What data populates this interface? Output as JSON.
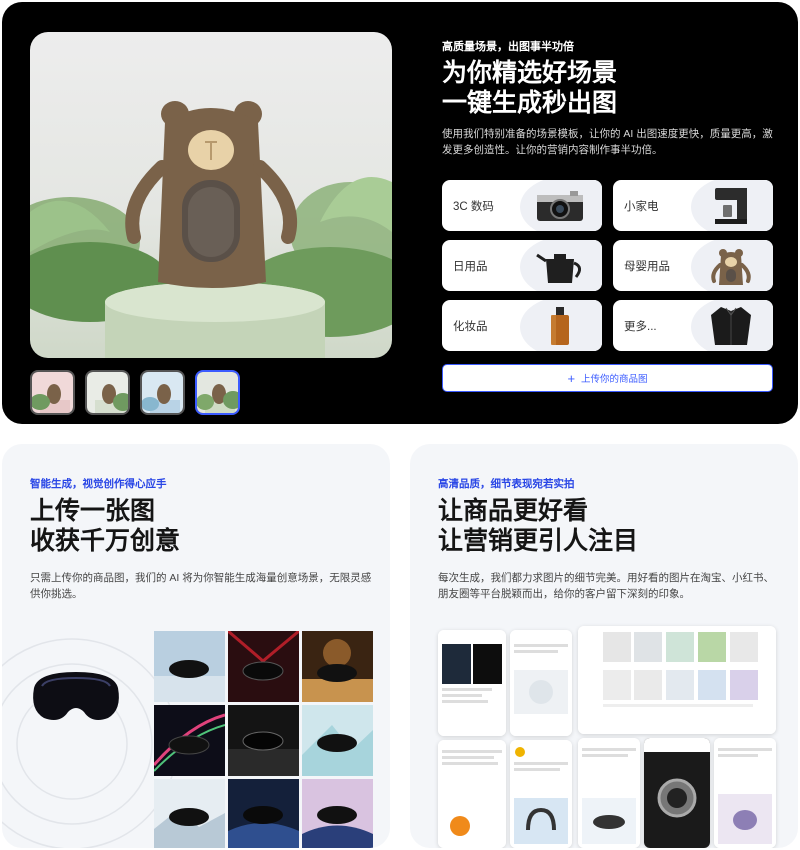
{
  "hero": {
    "eyebrow": "高质量场景，出图事半功倍",
    "title_line1": "为你精选好场景",
    "title_line2": "一键生成秒出图",
    "description": "使用我们特别准备的场景模板，让你的 AI 出图速度更快，质量更高，激发更多创造性。让你的营销内容制作事半功倍。",
    "categories": [
      {
        "label": "3C 数码",
        "icon": "camera-icon"
      },
      {
        "label": "小家电",
        "icon": "coffee-machine-icon"
      },
      {
        "label": "日用品",
        "icon": "kettle-icon"
      },
      {
        "label": "母婴用品",
        "icon": "bear-humidifier-icon"
      },
      {
        "label": "化妆品",
        "icon": "perfume-bottle-icon"
      },
      {
        "label": "更多...",
        "icon": "shirt-icon"
      }
    ],
    "upload_label": "上传你的商品图",
    "accent_color": "#3b5bff"
  },
  "card_left": {
    "eyebrow": "智能生成，视觉创作得心应手",
    "title_line1": "上传一张图",
    "title_line2": "收获千万创意",
    "description": "只需上传你的商品图，我们的 AI 将为你智能生成海量创意场景，无限灵感供你挑选。",
    "accent_color": "#2946e6"
  },
  "card_right": {
    "eyebrow": "高清品质，细节表现宛若实拍",
    "title_line1": "让商品更好看",
    "title_line2": "让营销更引人注目",
    "description": "每次生成，我们都力求图片的细节完美。用好看的图片在淘宝、小红书、朋友圈等平台脱颖而出，给你的客户留下深刻的印象。",
    "accent_color": "#2946e6"
  }
}
